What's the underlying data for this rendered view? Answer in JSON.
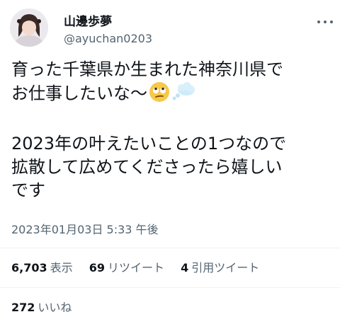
{
  "author": {
    "display_name": "山邊歩夢",
    "handle": "@ayuchan0203",
    "avatar_icon": "profile-photo"
  },
  "more_icon": "more-options-icon",
  "tweet": {
    "lines": [
      "育った千葉県か生まれた神奈川県で",
      "お仕事したいな〜"
    ],
    "emojis": [
      "face-with-rolling-eyes-emoji",
      "thought-balloon-emoji"
    ],
    "lines2": [
      "2023年の叶えたいことの1つなので",
      "拡散して広めてくださったら嬉しい",
      "です"
    ]
  },
  "timestamp": "2023年01月03日 5:33 午後",
  "stats": {
    "views": "6,703",
    "views_label": "表示",
    "retweets": "69",
    "retweets_label": "リツイート",
    "quotes": "4",
    "quotes_label": "引用ツイート",
    "likes": "272",
    "likes_label": "いいね"
  },
  "colors": {
    "text": "#0f1419",
    "secondary": "#536471",
    "divider": "#eff3f4"
  }
}
